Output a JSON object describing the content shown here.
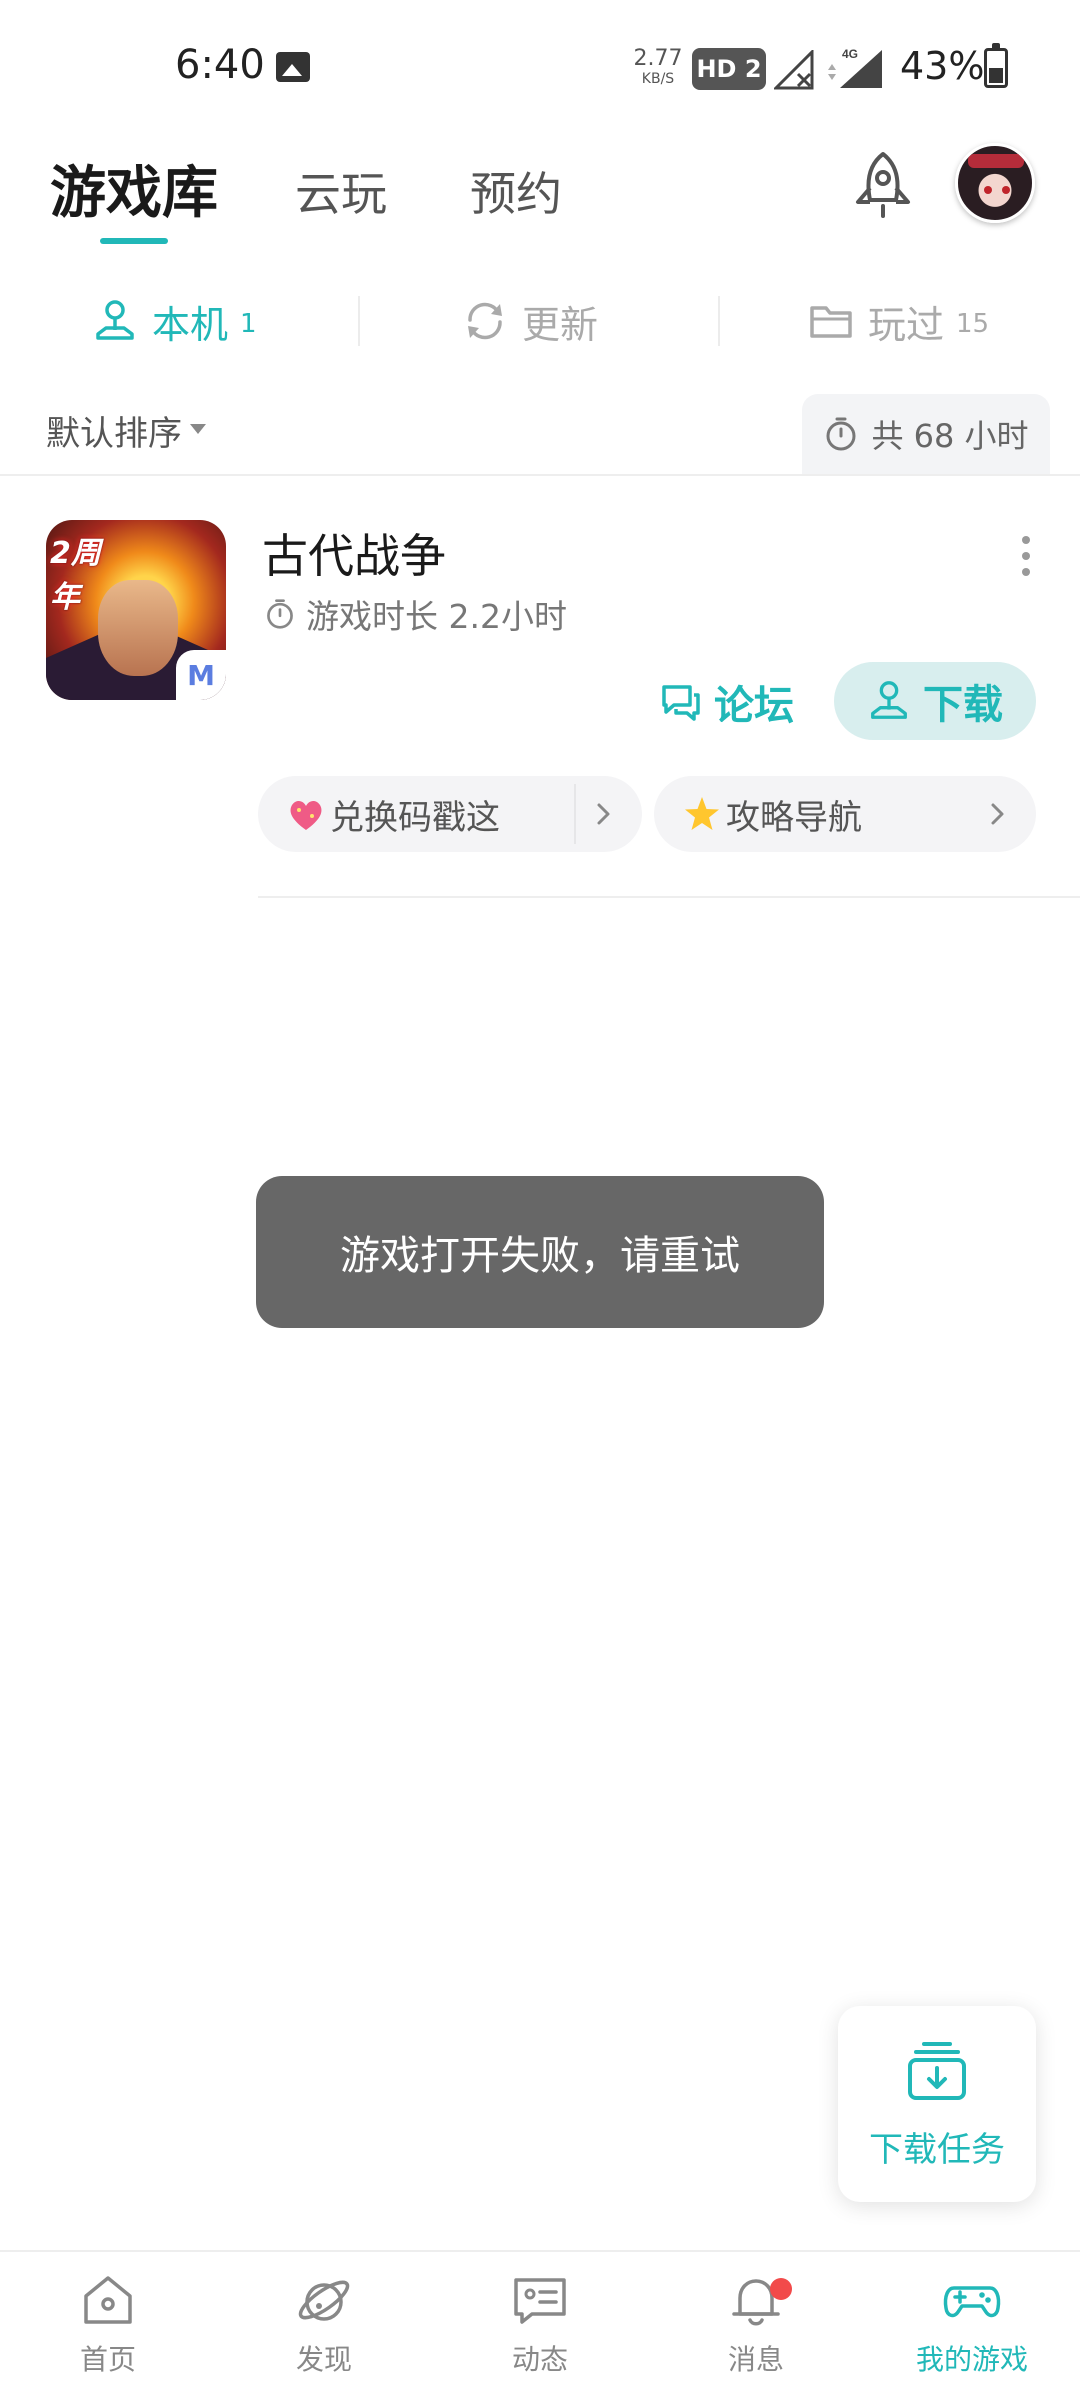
{
  "status_bar": {
    "time": "6:40",
    "net_speed_value": "2.77",
    "net_speed_unit": "KB/S",
    "hd_label": "HD 2",
    "network_type": "4G",
    "battery": "43%"
  },
  "top_tabs": {
    "tabs": [
      {
        "label": "游戏库",
        "active": true
      },
      {
        "label": "云玩",
        "active": false
      },
      {
        "label": "预约",
        "active": false
      }
    ]
  },
  "sub_tabs": [
    {
      "label": "本机",
      "count": "1",
      "icon": "joystick-icon",
      "active": true
    },
    {
      "label": "更新",
      "count": "",
      "icon": "refresh-icon",
      "active": false
    },
    {
      "label": "玩过",
      "count": "15",
      "icon": "folder-icon",
      "active": false
    }
  ],
  "sort": {
    "label": "默认排序",
    "total_playtime": "共 68 小时"
  },
  "game": {
    "title": "古代战争",
    "icon_badge_text": "2周年",
    "playtime": "游戏时长 2.2小时",
    "forum_label": "论坛",
    "download_label": "下载",
    "chips": [
      {
        "label": "兑换码戳这",
        "emoji": "sparkling-heart-icon"
      },
      {
        "label": "攻略导航",
        "emoji": "glowing-star-icon"
      }
    ]
  },
  "toast": {
    "message": "游戏打开失败，请重试"
  },
  "floating_download": {
    "label": "下载任务"
  },
  "bottom_nav": [
    {
      "label": "首页",
      "icon": "home-icon",
      "active": false
    },
    {
      "label": "发现",
      "icon": "planet-icon",
      "active": false
    },
    {
      "label": "动态",
      "icon": "chat-card-icon",
      "active": false
    },
    {
      "label": "消息",
      "icon": "bell-icon",
      "active": false,
      "badge": true
    },
    {
      "label": "我的游戏",
      "icon": "gamepad-icon",
      "active": true
    }
  ],
  "colors": {
    "accent": "#21b8b8",
    "toast_bg": "#676767",
    "badge_red": "#f24a4a"
  }
}
